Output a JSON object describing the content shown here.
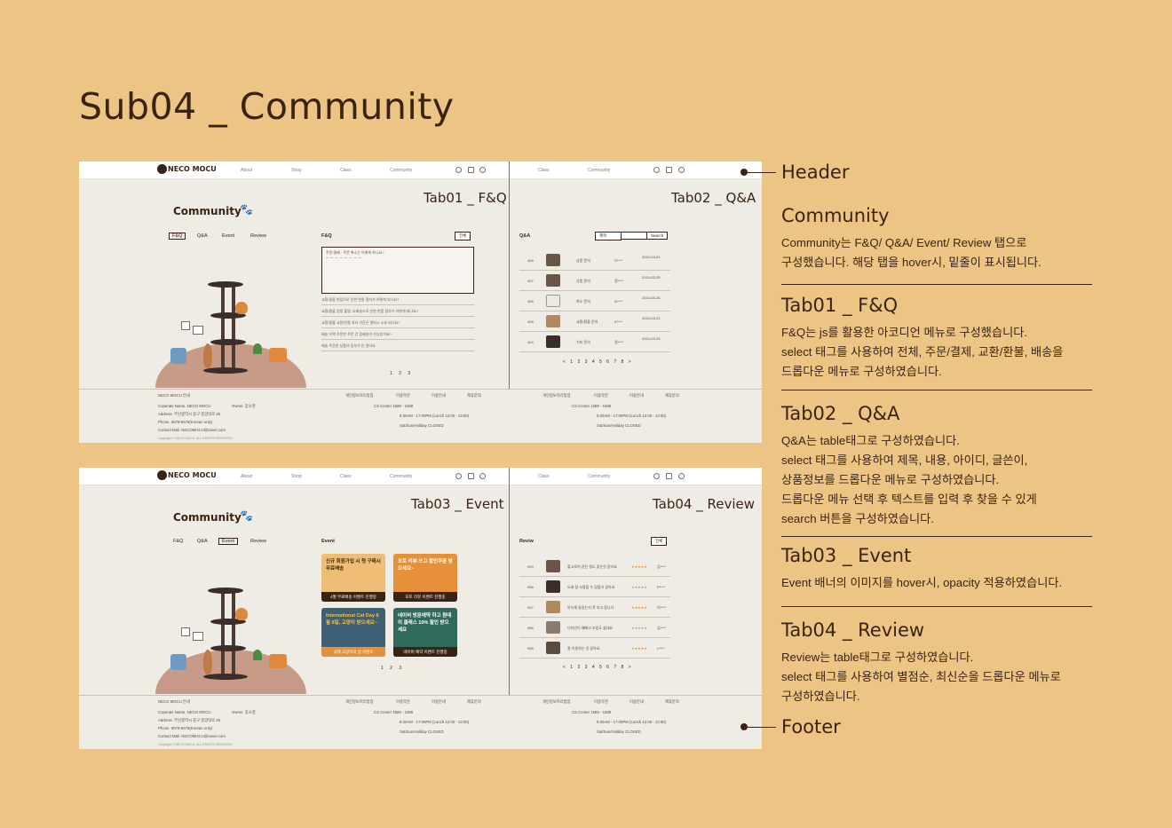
{
  "page_title": "Sub04 _ Community",
  "header": {
    "logo": "NECO MOCU",
    "nav": [
      "About",
      "Shop",
      "Class",
      "Community"
    ]
  },
  "mockups": {
    "tab01_label": "Tab01 _ F&Q",
    "tab02_label": "Tab02 _ Q&A",
    "tab03_label": "Tab03 _ Event",
    "tab04_label": "Tab04 _ Review",
    "community_title": "Community",
    "subtabs": [
      "F&Q",
      "Q&A",
      "Event",
      "Review"
    ],
    "faq_label": "F&Q",
    "faq_select": "전체",
    "faq_rows": [
      "교환/환불     변심으로 인한 반품 절차가 어떻게 되나요?",
      "교환/환불     상품 불량, 오배송으로 인한 반품 절차가 어떻게 되나요?",
      "교환/환불     교환/반품 처리 기간은 얼마나 소요 되나요?",
      "배송     지역 주문한 주문 건 합배송이 가능한가요?",
      "배송     주문한 상품의 일부가 안 왔어요."
    ],
    "faq_open_text": "주문/결제 · 주문 취소는 어떻게 하나요?",
    "faq_pager": "1 2 3",
    "qa_label": "Q&A",
    "qa_select": "제목",
    "qa_search": "Search",
    "qa_rows": [
      {
        "no": "408",
        "title": "상품 문의",
        "user": "S****",
        "date": "2024-04-01"
      },
      {
        "no": "407",
        "title": "상품 문의",
        "user": "정****",
        "date": "2024-03-29"
      },
      {
        "no": "406",
        "title": "취소 문의",
        "user": "A****",
        "date": "2024-03-26"
      },
      {
        "no": "405",
        "title": "교환/환불 문의",
        "user": "K****",
        "date": "2024-03-22"
      },
      {
        "no": "404",
        "title": "기타 문의",
        "user": "정****",
        "date": "2024-03-03"
      }
    ],
    "qa_pager": "< 1 2 3 4 5 6 7 8 >",
    "event_label": "Event",
    "events": [
      {
        "text": "신규 회원가입 시 첫 구매시 무료배송",
        "caption": "4월 무료배송 이벤트 진행중",
        "color": "#eebd76"
      },
      {
        "text": "포토 리뷰 쓰고 할인쿠폰 받으세요~",
        "caption": "포토 리뷰 이벤트 진행중",
        "color": "#e5913a"
      },
      {
        "text": "International Cat Day 8월 8일, 고양이 받으세요~",
        "caption": "국제 고양이의 날 이벤트",
        "color": "#3f5f74"
      },
      {
        "text": "네이버 방문예약 하고 원데이 클래스 10% 할인 받으세요",
        "caption": "네이버 예약 이벤트 진행중",
        "color": "#2f6a5d"
      }
    ],
    "event_pager": "1 2 3",
    "review_label": "Reviw",
    "review_select": "전체",
    "review_rows": [
      {
        "no": "999",
        "text": "불고로이 같은 정도 좋은것 같아요",
        "stars": "★★★★★",
        "user": "김****"
      },
      {
        "no": "998",
        "text": "오래 잘 사용할 수 있을거 같아요",
        "stars": "★★★★★",
        "user": "P****"
      },
      {
        "no": "997",
        "text": "아늑해 들었는지 푹 자고 합니다",
        "stars": "★★★★★",
        "user": "이****"
      },
      {
        "no": "996",
        "text": "디자인이 예뻐고 조립도 쉽네요",
        "stars": "★★★★★",
        "user": "김****"
      },
      {
        "no": "995",
        "text": "잘 이용하는 것 같아요",
        "stars": "★★★★★",
        "user": "L****"
      }
    ],
    "review_pager": "< 1 2 3 4 5 6 7 8 >",
    "footer": {
      "guide": "NECO MOCU 안내",
      "links": [
        "개인정보처리방침",
        "이용약관",
        "이용안내",
        "제휴문의"
      ],
      "company": "Coperate Name. NECO MOCU",
      "owner": "Owner. 장소영",
      "address": "Address. 부산광역시 중구 중앙대로 26",
      "phone": "Phone. 5678-5678(Korean only)",
      "mail": "Contact Mail. NECOMOCU@naver.com",
      "copyright": "Copyright © NECO MOCU. ALL RIGHTS RESERVED.",
      "cs": "CS Center    1588 - 1588",
      "hours": "9:30AM - 17:00PM (Lunch 12:00 - 13:00)",
      "closed": "Sat/Sun/Holiday CLOSED"
    }
  },
  "callouts": {
    "header": "Header",
    "footer": "Footer"
  },
  "sections": {
    "community": {
      "title": "Community",
      "lines": [
        "Community는 F&Q/ Q&A/ Event/ Review 탭으로",
        "구성했습니다. 해당 탭을 hover시, 밑줄이 표시됩니다."
      ]
    },
    "tab01": {
      "title": "Tab01 _ F&Q",
      "lines": [
        "F&Q는 js를 활용한 아코디언 메뉴로 구성했습니다.",
        "select 태그를 사용하여 전체, 주문/결제, 교환/환불, 배송을",
        "드롭다운 메뉴로 구성하였습니다."
      ]
    },
    "tab02": {
      "title": "Tab02 _ Q&A",
      "lines": [
        "Q&A는 table태그로 구성하였습니다.",
        "select 태그를 사용하여 제목, 내용, 아이디, 글쓴이,",
        "상품정보를 드롭다운 메뉴로 구성하였습니다.",
        "드롭다운 메뉴 선택 후 텍스트를 입력 후 찾을 수 있게",
        "search 버튼을 구성하였습니다."
      ]
    },
    "tab03": {
      "title": "Tab03 _ Event",
      "lines": [
        "Event 배너의 이미지를 hover시, opacity 적용하였습니다."
      ]
    },
    "tab04": {
      "title": "Tab04 _ Review",
      "lines": [
        "Review는 table태그로 구성하였습니다.",
        "select 태그를 사용하여 별점순, 최신순을 드롭다운 메뉴로",
        "구성하였습니다."
      ]
    }
  },
  "colors": {
    "background": "#ecc483",
    "text": "#3b2314",
    "mock_bg": "#efece6"
  }
}
